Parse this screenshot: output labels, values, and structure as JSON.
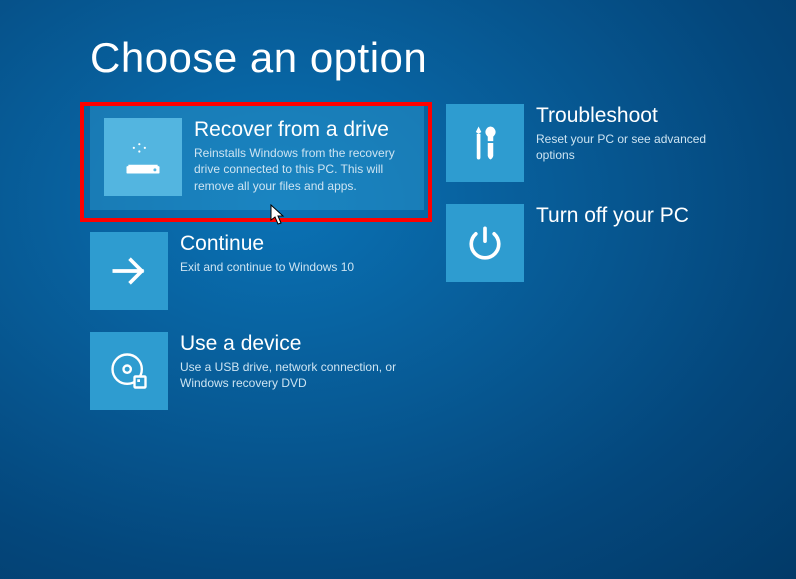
{
  "page_title": "Choose an option",
  "tiles": {
    "recover": {
      "title": "Recover from a drive",
      "desc": "Reinstalls Windows from the recovery drive connected to this PC. This will remove all your files and apps."
    },
    "continue": {
      "title": "Continue",
      "desc": "Exit and continue to Windows 10"
    },
    "usedevice": {
      "title": "Use a device",
      "desc": "Use a USB drive, network connection, or Windows recovery DVD"
    },
    "troubleshoot": {
      "title": "Troubleshoot",
      "desc": "Reset your PC or see advanced options"
    },
    "turnoff": {
      "title": "Turn off your PC",
      "desc": ""
    }
  }
}
